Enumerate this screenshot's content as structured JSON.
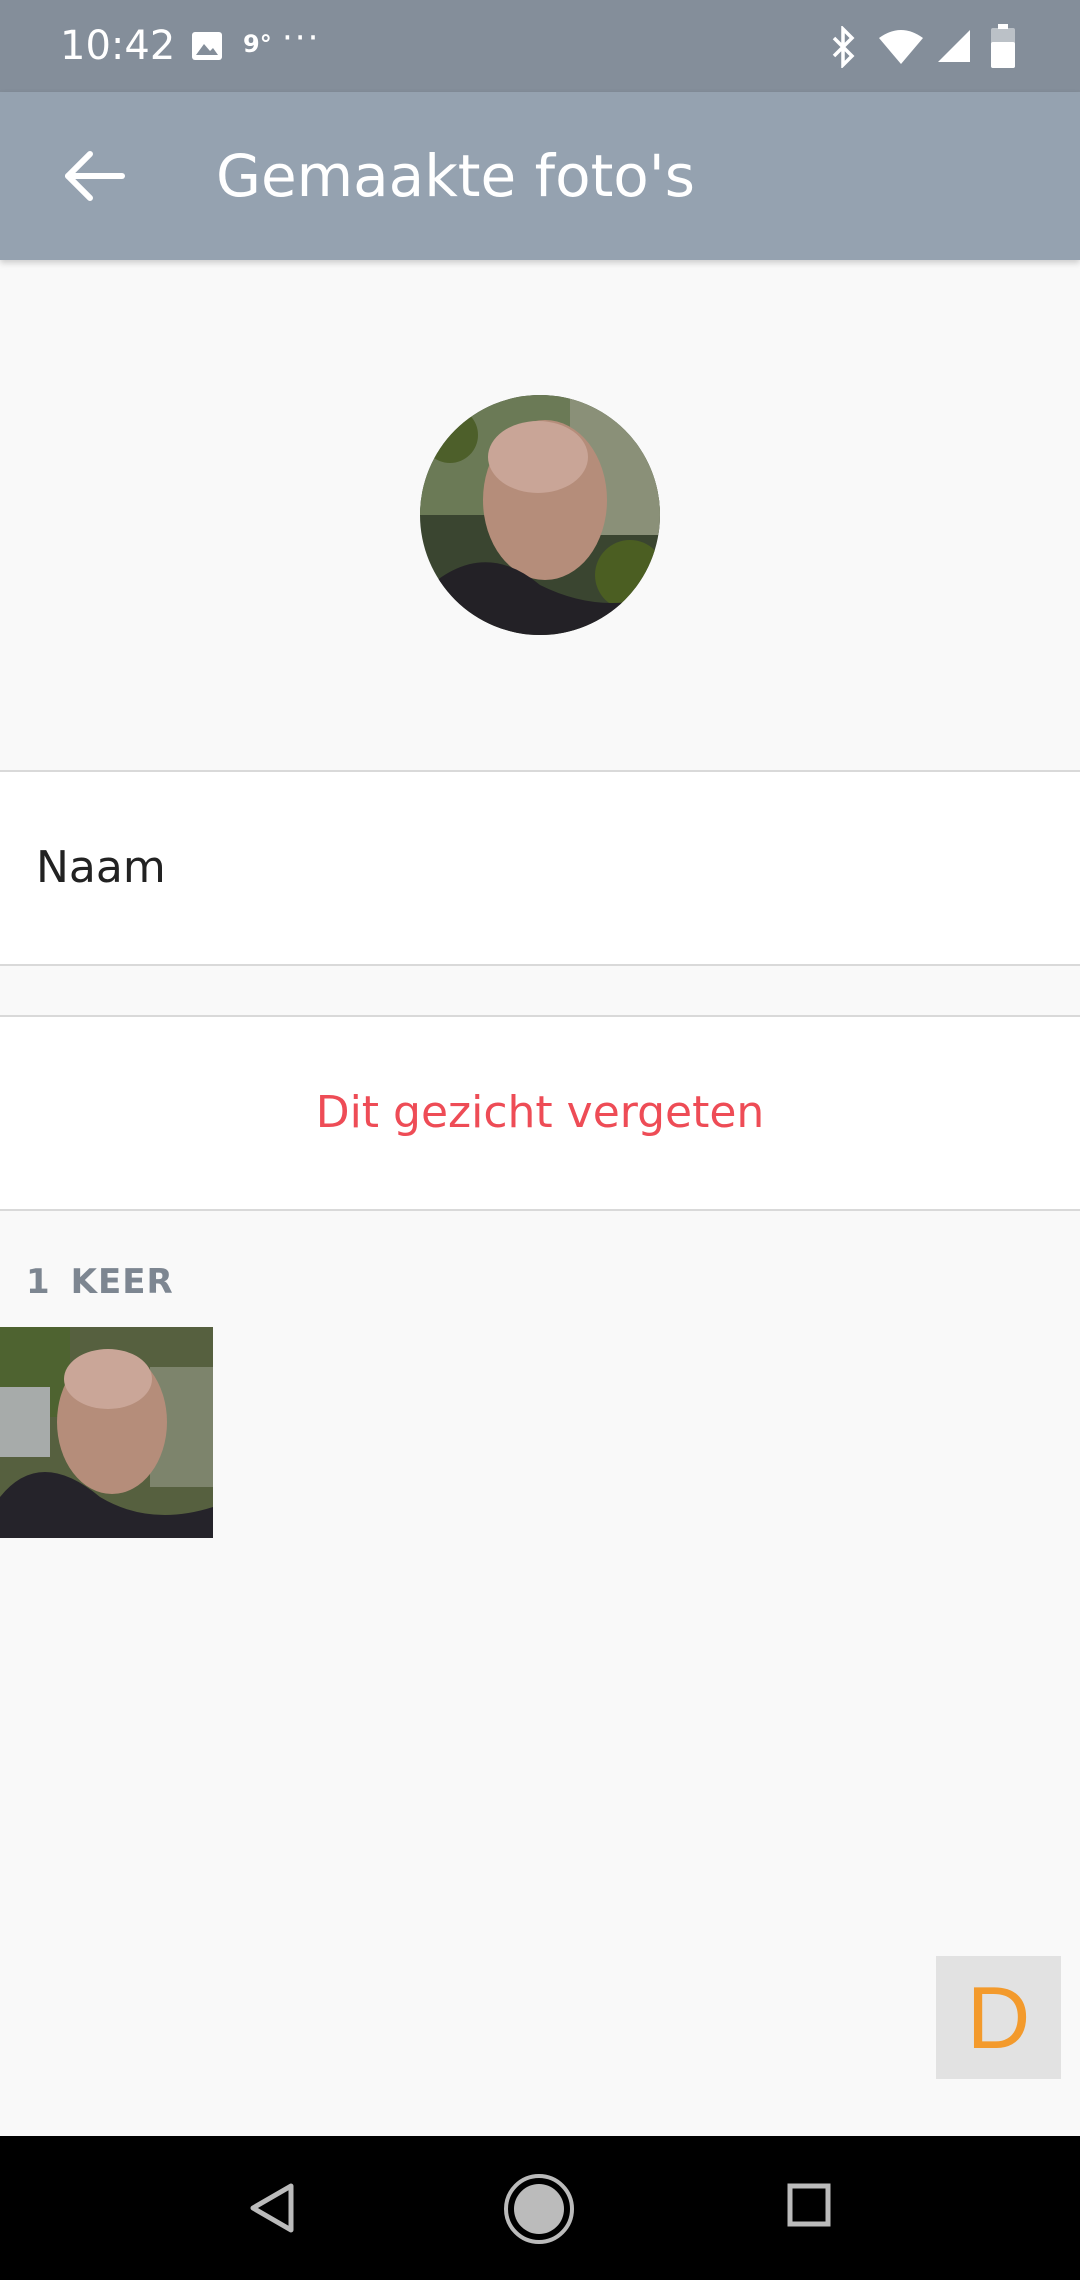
{
  "status_bar": {
    "time": "10:42",
    "temperature": "9°",
    "more_indicator": "···",
    "icons": [
      "image-icon",
      "bluetooth-icon",
      "wifi-icon",
      "signal-icon",
      "battery-icon"
    ]
  },
  "app_bar": {
    "title": "Gemaakte foto's",
    "back_icon": "arrow-left-icon"
  },
  "profile": {
    "name_placeholder": "Naam",
    "forget_label": "Dit gezicht vergeten"
  },
  "photos": {
    "count": "1",
    "count_label": "KEER"
  },
  "badge": {
    "letter": "D"
  },
  "nav_bar": {
    "icons": [
      "back-triangle-icon",
      "home-circle-icon",
      "recents-square-icon"
    ]
  },
  "colors": {
    "status_bar": "#848e9a",
    "app_bar": "#95a2b0",
    "danger": "#ee4c56",
    "badge_letter": "#f39a2c"
  }
}
